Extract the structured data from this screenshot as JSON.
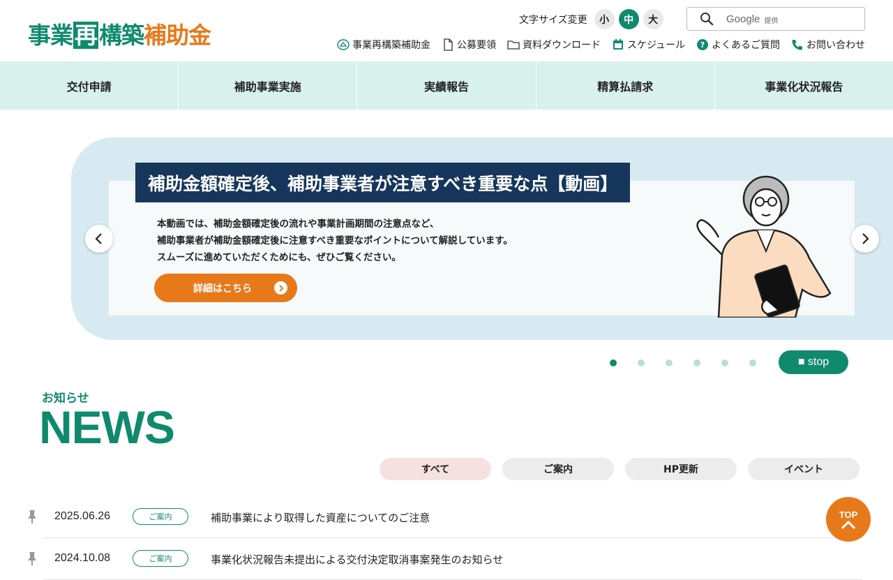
{
  "logo": {
    "part1": "事業",
    "part2": "再",
    "part3": "構築",
    "part4": "補助金"
  },
  "font_size": {
    "label": "文字サイズ変更",
    "small": "小",
    "medium": "中",
    "large": "大"
  },
  "search": {
    "placeholder": "Google",
    "provided": "提供"
  },
  "utility_links": [
    {
      "label": "事業再構築補助金",
      "icon": "building-icon"
    },
    {
      "label": "公募要領",
      "icon": "document-icon"
    },
    {
      "label": "資料ダウンロード",
      "icon": "folder-icon"
    },
    {
      "label": "スケジュール",
      "icon": "calendar-icon"
    },
    {
      "label": "よくあるご質問",
      "icon": "question-icon"
    },
    {
      "label": "お問い合わせ",
      "icon": "phone-icon"
    }
  ],
  "global_nav": [
    "交付申請",
    "補助事業実施",
    "実績報告",
    "精算払請求",
    "事業化状況報告"
  ],
  "slide": {
    "title": "補助金額確定後、補助事業者が注意すべき重要な点【動画】",
    "line1": "本動画では、補助金額確定後の流れや事業計画期間の注意点など、",
    "line2": "補助事業者が補助金額確定後に注意すべき重要なポイントについて解説しています。",
    "line3": "スムーズに進めていただくためにも、ぜひご覧ください。",
    "button": "詳細はこちら"
  },
  "stop_label": "■ stop",
  "news": {
    "heading_jp": "お知らせ",
    "heading_en": "NEWS",
    "filters": [
      "すべて",
      "ご案内",
      "HP更新",
      "イベント"
    ],
    "items": [
      {
        "date": "2025.06.26",
        "tag": "ご案内",
        "title": "補助事業により取得した資産についてのご注意"
      },
      {
        "date": "2024.10.08",
        "tag": "ご案内",
        "title": "事業化状況報告未提出による交付決定取消事案発生のお知らせ"
      }
    ]
  },
  "top_label": "TOP",
  "colors": {
    "brand_green": "#0f8a6e",
    "accent_orange": "#e8791a",
    "nav_bg": "#d8f1ec",
    "slide_title_bg": "#17365c"
  }
}
